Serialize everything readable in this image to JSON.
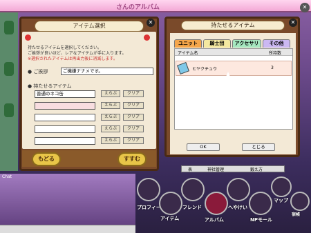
{
  "app": {
    "album_title": "さんのアルバム"
  },
  "item_select": {
    "title": "アイテム選択",
    "desc_line1": "持たせるアイテムを選択してください。",
    "desc_line2": "ご挨拶が良いほど、レアなアイテムが手に入ります。",
    "desc_line3": "※選択されたアイテムは再出力後に消滅します。",
    "greeting_label": "ご挨拶",
    "greeting_value": "ご機嫌ナナメです。",
    "items_label": "持たせるアイテム",
    "rows": [
      {
        "value": "普通のネコ缶",
        "pick": "えらぶ",
        "clear": "クリア"
      },
      {
        "value": "",
        "pick": "えらぶ",
        "clear": "クリア"
      },
      {
        "value": "",
        "pick": "えらぶ",
        "clear": "クリア"
      },
      {
        "value": "",
        "pick": "えらぶ",
        "clear": "クリア"
      },
      {
        "value": "",
        "pick": "えらぶ",
        "clear": "クリア"
      }
    ],
    "back": "もどる",
    "next": "すすむ"
  },
  "holdable": {
    "title": "持たせるアイテム",
    "tabs": [
      "ユニット",
      "騎士団",
      "アクセサリ",
      "その他"
    ],
    "col_name": "アイテム名",
    "col_count": "所持数",
    "item_name": "ヒヤクチュウ",
    "item_count": "3",
    "ok": "OK",
    "close": "とじる"
  },
  "mgmt": {
    "a": "表",
    "b": "神社管理",
    "c": "鍛え方"
  },
  "chat": {
    "label": "Chat"
  },
  "dock": {
    "profile": "プロフィール",
    "item": "アイテム",
    "friend": "フレンド",
    "album": "アルバム",
    "room": "へやけい",
    "np": "NPモール",
    "map": "マップ",
    "bell": "宿帳"
  }
}
